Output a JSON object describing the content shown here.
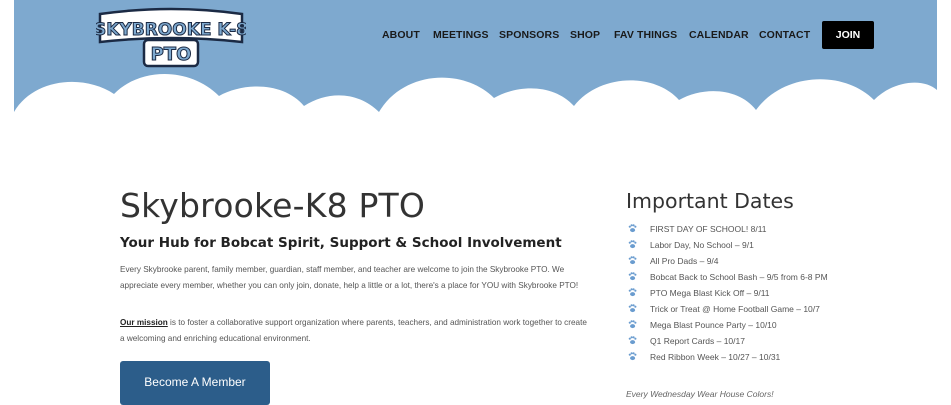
{
  "colors": {
    "sky": "#7ea9cf",
    "cloud": "#ffffff",
    "join_bg": "#000000",
    "button_bg": "#2c5d8a",
    "paw": "#6a9ccf"
  },
  "logo": {
    "line1": "SKYBROOKE K-8",
    "line2": "PTO"
  },
  "nav": {
    "items": [
      "ABOUT",
      "MEETINGS",
      "SPONSORS",
      "SHOP",
      "FAV THINGS",
      "CALENDAR",
      "CONTACT"
    ],
    "join_label": "JOIN"
  },
  "main": {
    "title": "Skybrooke-K8 PTO",
    "subtitle": "Your Hub for Bobcat Spirit, Support & School Involvement",
    "para1": "Every Skybrooke parent, family member, guardian, staff member, and teacher are welcome to join the Skybrooke PTO. We appreciate every member, whether you can only join, donate, help a little or a lot, there's a place for YOU with Skybrooke PTO!",
    "mission_label": "Our mission",
    "para2": " is to foster a collaborative support organization where parents, teachers, and administration work together to create a welcoming and enriching educational environment.",
    "member_button": "Become A Member"
  },
  "dates": {
    "title": "Important Dates",
    "items": [
      "FIRST DAY OF SCHOOL! 8/11",
      "Labor Day, No School – 9/1",
      "All Pro Dads – 9/4",
      "Bobcat Back to School Bash – 9/5 from 6-8 PM",
      "PTO Mega Blast Kick Off – 9/11",
      "Trick or Treat @ Home Football Game – 10/7",
      "Mega Blast Pounce Party – 10/10",
      "Q1 Report Cards – 10/17",
      "Red Ribbon Week – 10/27 – 10/31"
    ],
    "note": "Every Wednesday Wear House Colors!",
    "icon": "paw-icon"
  }
}
